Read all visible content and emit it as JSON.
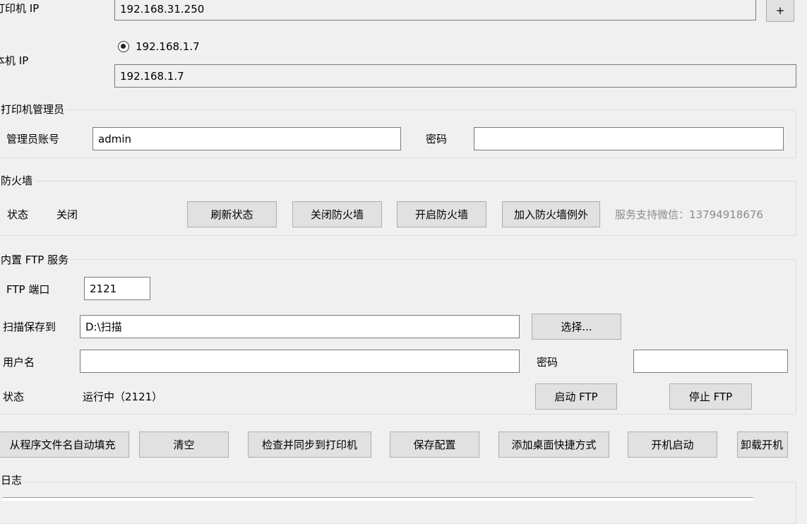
{
  "printer_ip": {
    "label": "打印机 IP",
    "value": "192.168.31.250",
    "add_label": "+"
  },
  "local_ip": {
    "label": "本机 IP",
    "option": "192.168.1.7",
    "value": "192.168.1.7"
  },
  "admin_group": {
    "title": "打印机管理员",
    "account_label": "管理员账号",
    "account_value": "admin",
    "password_label": "密码",
    "password_value": ""
  },
  "firewall": {
    "title": "防火墙",
    "status_label": "状态",
    "status_value": "关闭",
    "refresh_label": "刷新状态",
    "disable_label": "关闭防火墙",
    "enable_label": "开启防火墙",
    "exception_label": "加入防火墙例外",
    "support_text": "服务支持微信：13794918676"
  },
  "ftp": {
    "title": "内置 FTP 服务",
    "port_label": "FTP 端口",
    "port_value": "2121",
    "save_to_label": "扫描保存到",
    "save_to_value": "D:\\扫描",
    "choose_label": "选择...",
    "username_label": "用户名",
    "username_value": "",
    "password_label": "密码",
    "password_value": "",
    "status_label": "状态",
    "status_value": "运行中（2121）",
    "start_label": "启动 FTP",
    "stop_label": "停止 FTP"
  },
  "actions": {
    "autofill_label": "从程序文件名自动填充",
    "clear_label": "清空",
    "sync_label": "检查并同步到打印机",
    "save_label": "保存配置",
    "shortcut_label": "添加桌面快捷方式",
    "autostart_label": "开机启动",
    "uninstall_label": "卸载开机"
  },
  "log": {
    "title": "日志"
  }
}
